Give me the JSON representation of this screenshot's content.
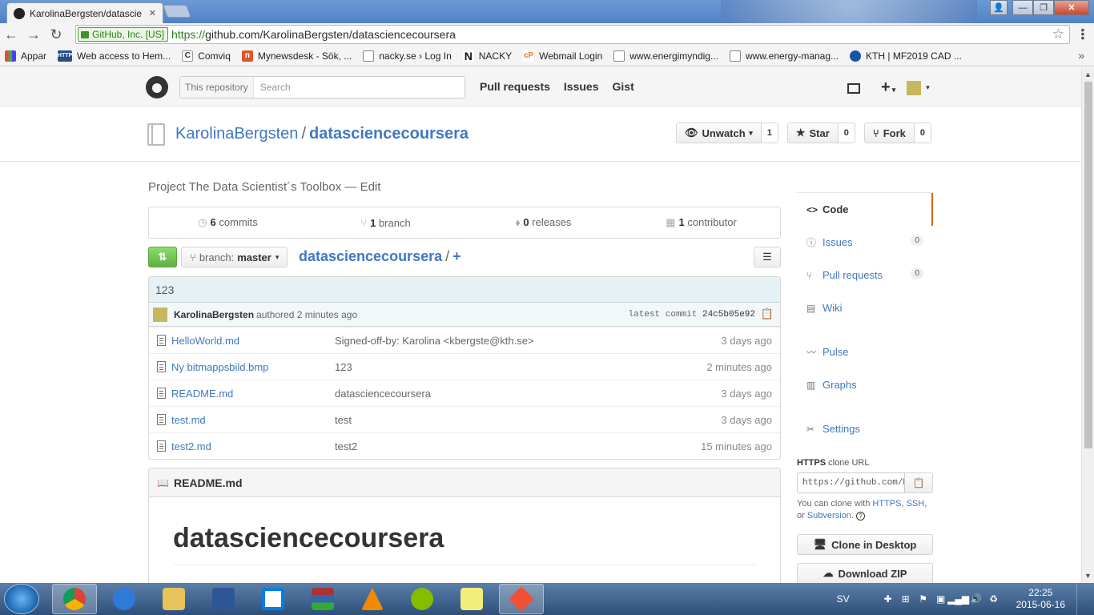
{
  "browser": {
    "tab_title": "KarolinaBergsten/datascie",
    "ev_label": "GitHub, Inc. [US]",
    "url_scheme": "https://",
    "url_rest": "github.com/KarolinaBergsten/datasciencecoursera",
    "bookmarks": [
      {
        "label": "Appar",
        "icon": "apps-grid-icon"
      },
      {
        "label": "Web access to Hem...",
        "icon": "web-access-icon"
      },
      {
        "label": "Comviq",
        "icon": "comviq-icon"
      },
      {
        "label": "Mynewsdesk - Sök, ...",
        "icon": "mynewsdesk-icon"
      },
      {
        "label": "nacky.se › Log In",
        "icon": "page-icon"
      },
      {
        "label": "NACKY",
        "icon": "nacky-icon"
      },
      {
        "label": "Webmail Login",
        "icon": "cpanel-icon"
      },
      {
        "label": "www.energimyndig...",
        "icon": "page-icon"
      },
      {
        "label": "www.energy-manag...",
        "icon": "page-icon"
      },
      {
        "label": "KTH | MF2019 CAD ...",
        "icon": "kth-icon"
      }
    ],
    "bookmarks_more": "»"
  },
  "github": {
    "search_scope": "This repository",
    "search_placeholder": "Search",
    "nav": [
      "Pull requests",
      "Issues",
      "Gist"
    ],
    "owner": "KarolinaBergsten",
    "separator": "/",
    "repo": "datasciencecoursera",
    "actions": {
      "watch_label": "Unwatch",
      "watch_count": "1",
      "star_label": "Star",
      "star_count": "0",
      "fork_label": "Fork",
      "fork_count": "0"
    },
    "description": "Project The Data Scientist´s Toolbox — Edit",
    "summary": {
      "commits_num": "6",
      "commits_label": "commits",
      "branch_num": "1",
      "branch_label": "branch",
      "releases_num": "0",
      "releases_label": "releases",
      "contributor_num": "1",
      "contributor_label": "contributor"
    },
    "branch_prefix": "branch:",
    "branch_name": "master",
    "breadcrumb_repo": "datasciencecoursera",
    "breadcrumb_plus": "+",
    "latest_commit": {
      "message": "123",
      "author": "KarolinaBergsten",
      "authored": "authored 2 minutes ago",
      "sha_label": "latest commit",
      "sha": "24c5b05e92"
    },
    "files": [
      {
        "name": "HelloWorld.md",
        "message": "Signed-off-by: Karolina <kbergste@kth.se>",
        "age": "3 days ago"
      },
      {
        "name": "Ny bitmappsbild.bmp",
        "message": "123",
        "age": "2 minutes ago"
      },
      {
        "name": "README.md",
        "message": "datasciencecoursera",
        "age": "3 days ago"
      },
      {
        "name": "test.md",
        "message": "test",
        "age": "3 days ago"
      },
      {
        "name": "test2.md",
        "message": "test2",
        "age": "15 minutes ago"
      }
    ],
    "readme": {
      "header": "README.md",
      "h1": "datasciencecoursera"
    },
    "sidebar": {
      "code": "Code",
      "issues": "Issues",
      "issues_count": "0",
      "pulls": "Pull requests",
      "pulls_count": "0",
      "wiki": "Wiki",
      "pulse": "Pulse",
      "graphs": "Graphs",
      "settings": "Settings"
    },
    "clone": {
      "protocol": "HTTPS",
      "label": "clone URL",
      "url": "https://github.com/KarolinaBergsten/datasciencecoursera.git",
      "help_prefix": "You can clone with",
      "https": "HTTPS",
      "ssh": "SSH",
      "svn": "Subversion",
      "help_or": "or",
      "help_q": "?",
      "desktop_btn": "Clone in Desktop",
      "zip_btn": "Download ZIP"
    }
  },
  "taskbar": {
    "lang": "SV",
    "time": "22:25",
    "date": "2015-06-16"
  }
}
